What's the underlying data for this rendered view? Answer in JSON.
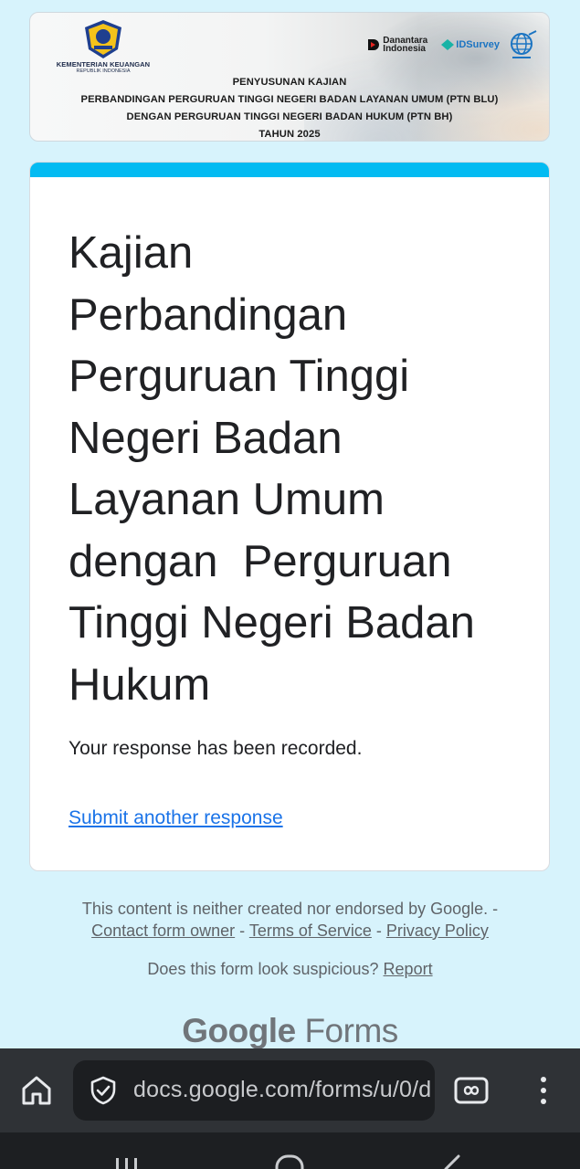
{
  "banner": {
    "ministry_name": "KEMENTERIAN KEUANGAN",
    "ministry_sub": "REPUBLIK INDONESIA",
    "partner_danantara": "Danantara Indonesia",
    "partner_idsurvey": "IDSurvey",
    "lines": [
      "PENYUSUNAN KAJIAN",
      "PERBANDINGAN PERGURUAN TINGGI NEGERI BADAN LAYANAN UMUM (PTN BLU)",
      "DENGAN PERGURUAN TINGGI NEGERI BADAN HUKUM (PTN BH)",
      "TAHUN 2025"
    ]
  },
  "card": {
    "accent_color": "#03bbf2",
    "title": "Kajian\nPerbandingan\nPerguruan Tinggi\nNegeri Badan\nLayanan Umum\ndengan  Perguruan\nTinggi Negeri Badan\nHukum",
    "confirmation": "Your response has been recorded.",
    "submit_another": "Submit another response"
  },
  "footer": {
    "disclaimer": "This content is neither created nor endorsed by Google. -",
    "contact_owner": "Contact form owner",
    "sep1": " - ",
    "terms": "Terms of Service",
    "sep2": " - ",
    "privacy": "Privacy Policy",
    "suspicious": "Does this form look suspicious?",
    "report": "Report",
    "logo_google": "Google",
    "logo_forms": "Forms"
  },
  "browser": {
    "url": "docs.google.com/forms/u/0/d",
    "home_icon": "home-icon",
    "security_icon": "shield-check-icon",
    "tabs_icon": "tabs-icon",
    "menu_icon": "more-vert-icon"
  },
  "navbar": {
    "recents_icon": "recents-icon",
    "home_icon": "home-circle-icon",
    "back_icon": "back-icon"
  }
}
